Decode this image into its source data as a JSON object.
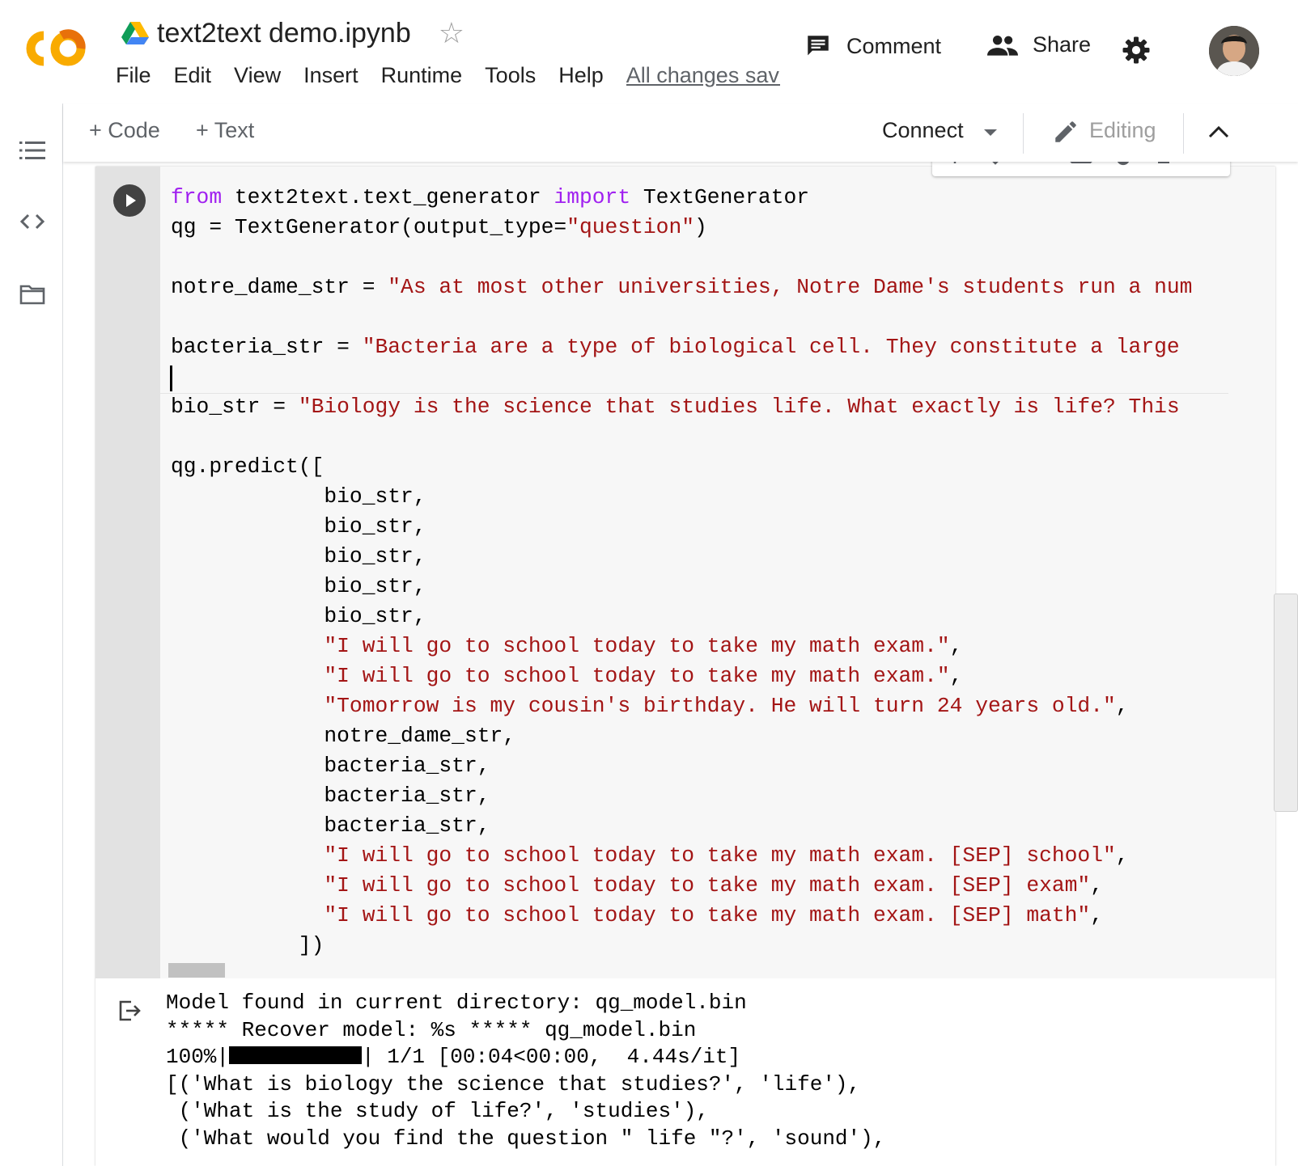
{
  "header": {
    "logo_text": "CO",
    "title": "text2text demo.ipynb",
    "menu": [
      "File",
      "Edit",
      "View",
      "Insert",
      "Runtime",
      "Tools",
      "Help"
    ],
    "save_status": "All changes saved",
    "comment_label": "Comment",
    "share_label": "Share"
  },
  "toolbar": {
    "code_label": "+ Code",
    "text_label": "+ Text",
    "connect_label": "Connect",
    "editing_label": "Editing"
  },
  "cell": {
    "code_lines": [
      "from text2text.text_generator import TextGenerator",
      "qg = TextGenerator(output_type=\"question\")",
      "",
      "notre_dame_str = \"As at most other universities, Notre Dame's students run a num",
      "",
      "bacteria_str = \"Bacteria are a type of biological cell. They constitute a large",
      "",
      "bio_str = \"Biology is the science that studies life. What exactly is life? This",
      "",
      "qg.predict([",
      "            bio_str,",
      "            bio_str,",
      "            bio_str,",
      "            bio_str,",
      "            bio_str,",
      "            \"I will go to school today to take my math exam.\",",
      "            \"I will go to school today to take my math exam.\",",
      "            \"Tomorrow is my cousin's birthday. He will turn 24 years old.\",",
      "            notre_dame_str,",
      "            bacteria_str,",
      "            bacteria_str,",
      "            bacteria_str,",
      "            \"I will go to school today to take my math exam. [SEP] school\",",
      "            \"I will go to school today to take my math exam. [SEP] exam\",",
      "            \"I will go to school today to take my math exam. [SEP] math\",",
      "          ])"
    ],
    "output_lines": [
      "Model found in current directory: qg_model.bin",
      "***** Recover model: %s ***** qg_model.bin",
      "",
      "[('What is biology the science that studies?', 'life'),",
      " ('What is the study of life?', 'studies'),",
      " ('What would you find the question \" life \"?', 'sound'),"
    ],
    "progress": {
      "percent_label": "100%",
      "fraction": 1.0,
      "counter": "1/1",
      "timing": "[00:04<00:00,  4.44s/it]"
    }
  },
  "colors": {
    "keyword": "#a020f0",
    "string": "#a31515",
    "logo_orange": "#f9ab00"
  }
}
